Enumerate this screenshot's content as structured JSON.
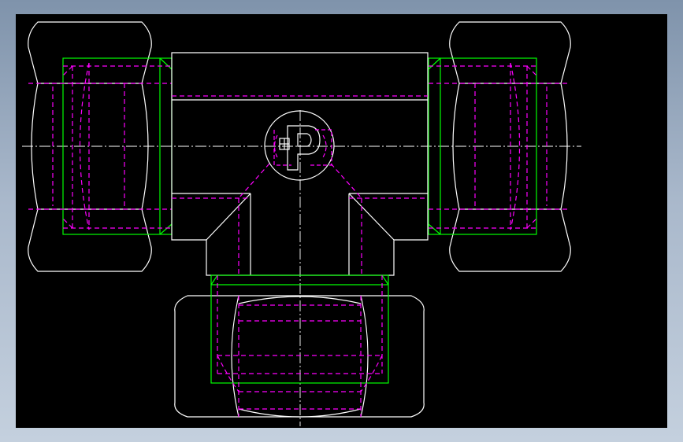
{
  "drawing": {
    "background_color": "#000000",
    "frame_gradient": [
      "#7f93ab",
      "#c4d0de"
    ],
    "colors": {
      "outline": "#ffffff",
      "hidden_lines": "#ff00ff",
      "thread_lines": "#00ff00",
      "center_lines": "#ffffff"
    },
    "components": [
      "left-hex-nut",
      "right-hex-nut",
      "bottom-hex-nut",
      "tee-body",
      "manufacturer-logo"
    ]
  }
}
